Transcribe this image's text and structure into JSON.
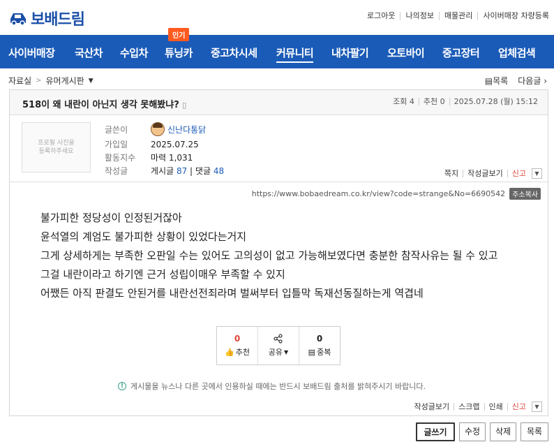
{
  "logo": {
    "text": "보배드림"
  },
  "toplinks": [
    "로그아웃",
    "나의정보",
    "매물관리",
    "사이버매장 차량등록"
  ],
  "nav": {
    "items": [
      "사이버매장",
      "국산차",
      "수입차",
      "튜닝카",
      "중고차시세",
      "커뮤니티",
      "내차팔기",
      "오토바이",
      "중고장터",
      "업체검색"
    ],
    "active": "커뮤니티",
    "hot_badge": "인기"
  },
  "breadcrumb": {
    "section": "자료실",
    "board": "유머게시판"
  },
  "right_nav": {
    "list": "목록",
    "next": "다음글"
  },
  "post": {
    "title": "518이 왜 내란이 아닌지 생각 못해봤냐?",
    "meta": {
      "views": "조회 4",
      "recommend": "추천 0",
      "date": "2025.07.28 (월) 15:12"
    }
  },
  "author": {
    "avatar_placeholder": "프로필 사진을\n등록하주세요",
    "labels": {
      "writer": "글쓴이",
      "joined": "가입일",
      "activity": "활동지수",
      "posts": "작성글"
    },
    "name": "신난다통닭",
    "joined": "2025.07.25",
    "activity": "마력 1,031",
    "posts_label": "게시글",
    "posts_count": "87",
    "comments_label": "댓글",
    "comments_count": "48",
    "actions": {
      "note": "쪽지",
      "view_posts": "작성글보기",
      "report": "신고"
    }
  },
  "url": {
    "text": "https://www.bobaedream.co.kr/view?code=strange&No=6690542",
    "copy_label": "주소복사"
  },
  "content": [
    "불가피한 정당성이 인정된거잖아",
    "윤석열의 계엄도 불가피한 상황이 있었다는거지",
    "그게 상세하게는 부족한 오판일 수는 있어도 고의성이 없고 가능해보였다면 충분한 참작사유는 될 수 있고",
    "그걸 내란이라고 하기엔 근거 성립이매우 부족할 수 있지",
    "어쨌든 아직 판결도 안된거를 내란선전죄라며 벌써부터 입틀막 독재선동질하는게 역겹네"
  ],
  "votes": {
    "recommend_count": "0",
    "recommend_label": "추천",
    "share_label": "공유",
    "duplicate_count": "0",
    "duplicate_label": "중복"
  },
  "notice": "게시물을 뉴스나 다른 곳에서 인용하실 때에는 반드시 보배드림 출처를 밝혀주시기 바랍니다.",
  "bottom_actions": {
    "view_posts": "작성글보기",
    "scrap": "스크랩",
    "print": "인쇄",
    "report": "신고"
  },
  "buttons": {
    "write": "글쓰기",
    "edit": "수정",
    "delete": "삭제",
    "list": "목록"
  },
  "colors": {
    "brand": "#1b5bb8",
    "hot": "#ff5a1f",
    "report": "#e0443a"
  }
}
